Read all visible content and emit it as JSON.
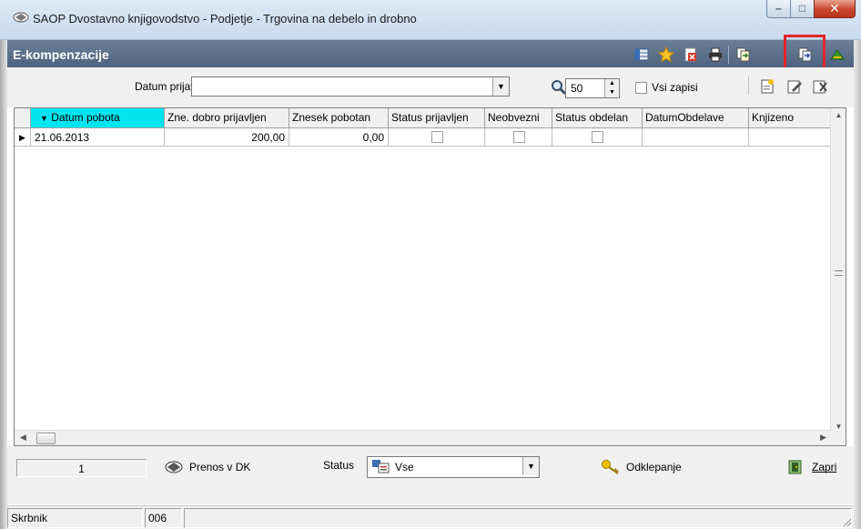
{
  "window": {
    "title": "SAOP Dvostavno knjigovodstvo - Podjetje - Trgovina na debelo in drobno",
    "buttons": [
      "minimize-icon",
      "maximize-icon",
      "close-icon"
    ]
  },
  "form": {
    "title": "E-kompenzacije",
    "toolbar_icons": [
      "columns-icon",
      "favorite-star-icon",
      "export-icon",
      "print-icon",
      "copy-record-icon",
      "import-record-icon",
      "exit-icon"
    ],
    "highlighted_icon": "import-record-icon"
  },
  "filter": {
    "date_label": "Datum prijave",
    "date_value": "",
    "search_icon": "magnifier-icon",
    "record_limit": "50",
    "all_records_label": "Vsi zapisi",
    "all_records_checked": false,
    "action_icons": [
      "new-document-icon",
      "edit-document-icon",
      "delete-document-icon"
    ]
  },
  "grid": {
    "columns": [
      {
        "label": "Datum pobota",
        "sorted": true,
        "sort_icon": "sort-desc-icon"
      },
      {
        "label": "Zne. dobro prijavljen"
      },
      {
        "label": "Znesek pobotan"
      },
      {
        "label": "Status prijavljen"
      },
      {
        "label": "Neobvezni"
      },
      {
        "label": "Status obdelan"
      },
      {
        "label": "DatumObdelave"
      },
      {
        "label": "Knjizeno"
      }
    ],
    "rows": [
      {
        "current": true,
        "datum_pobota": "21.06.2013",
        "zne_dobro_prijavljen": "200,00",
        "znesek_pobotan": "0,00",
        "status_prijavljen": false,
        "neobvezni": false,
        "status_obdelan": false,
        "datum_obdelave": "",
        "knjizeno": ""
      }
    ]
  },
  "bottom": {
    "counter": "1",
    "transfer_label": "Prenos v DK",
    "status_label": "Status",
    "status_value": "Vse",
    "unlock_label": "Odklepanje",
    "close_label": "Zapri"
  },
  "statusbar": {
    "user": "Skrbnik",
    "code": "006",
    "message": ""
  },
  "colors": {
    "title_bar": "#c9dbee",
    "form_header": "#5a6d88",
    "active_column": "#00e5ef",
    "highlight": "#e3242b",
    "close_button": "#c7462c"
  }
}
